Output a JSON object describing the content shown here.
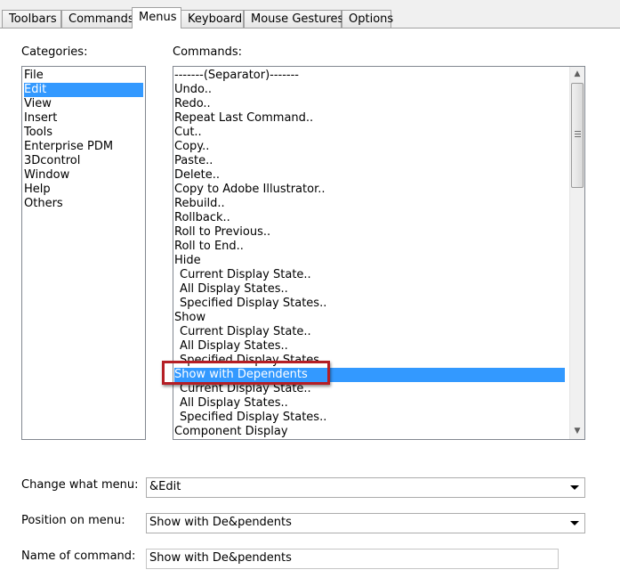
{
  "tabs": [
    {
      "label": "Toolbars",
      "active": false
    },
    {
      "label": "Commands",
      "active": false
    },
    {
      "label": "Menus",
      "active": true
    },
    {
      "label": "Keyboard",
      "active": false
    },
    {
      "label": "Mouse Gestures",
      "active": false
    },
    {
      "label": "Options",
      "active": false
    }
  ],
  "categories": {
    "label": "Categories:",
    "items": [
      "File",
      "Edit",
      "View",
      "Insert",
      "Tools",
      "Enterprise PDM",
      "3Dcontrol",
      "Window",
      "Help",
      "Others"
    ],
    "selected": "Edit"
  },
  "commands": {
    "label": "Commands:",
    "items": [
      "-------(Separator)-------",
      "Undo..",
      "Redo..",
      "Repeat Last Command..",
      "Cut..",
      "Copy..",
      "Paste..",
      "Delete..",
      "Copy to Adobe Illustrator..",
      "Rebuild..",
      "Rollback..",
      "Roll to Previous..",
      "Roll to End..",
      "Hide",
      " Current Display State..",
      " All Display States..",
      " Specified Display States..",
      "Show",
      " Current Display State..",
      " All Display States..",
      " Specified Display States..",
      "Show with Dependents",
      " Current Display State..",
      " All Display States..",
      " Specified Display States..",
      "Component Display"
    ],
    "selected": "Show with Dependents"
  },
  "form": {
    "change_menu_label": "Change what menu:",
    "change_menu_value": "&Edit",
    "position_label": "Position on menu:",
    "position_value": "Show with De&pendents",
    "name_label": "Name of command:",
    "name_value": "Show with De&pendents"
  },
  "colors": {
    "selection": "#3399ff",
    "highlight_box": "#b51e25"
  }
}
